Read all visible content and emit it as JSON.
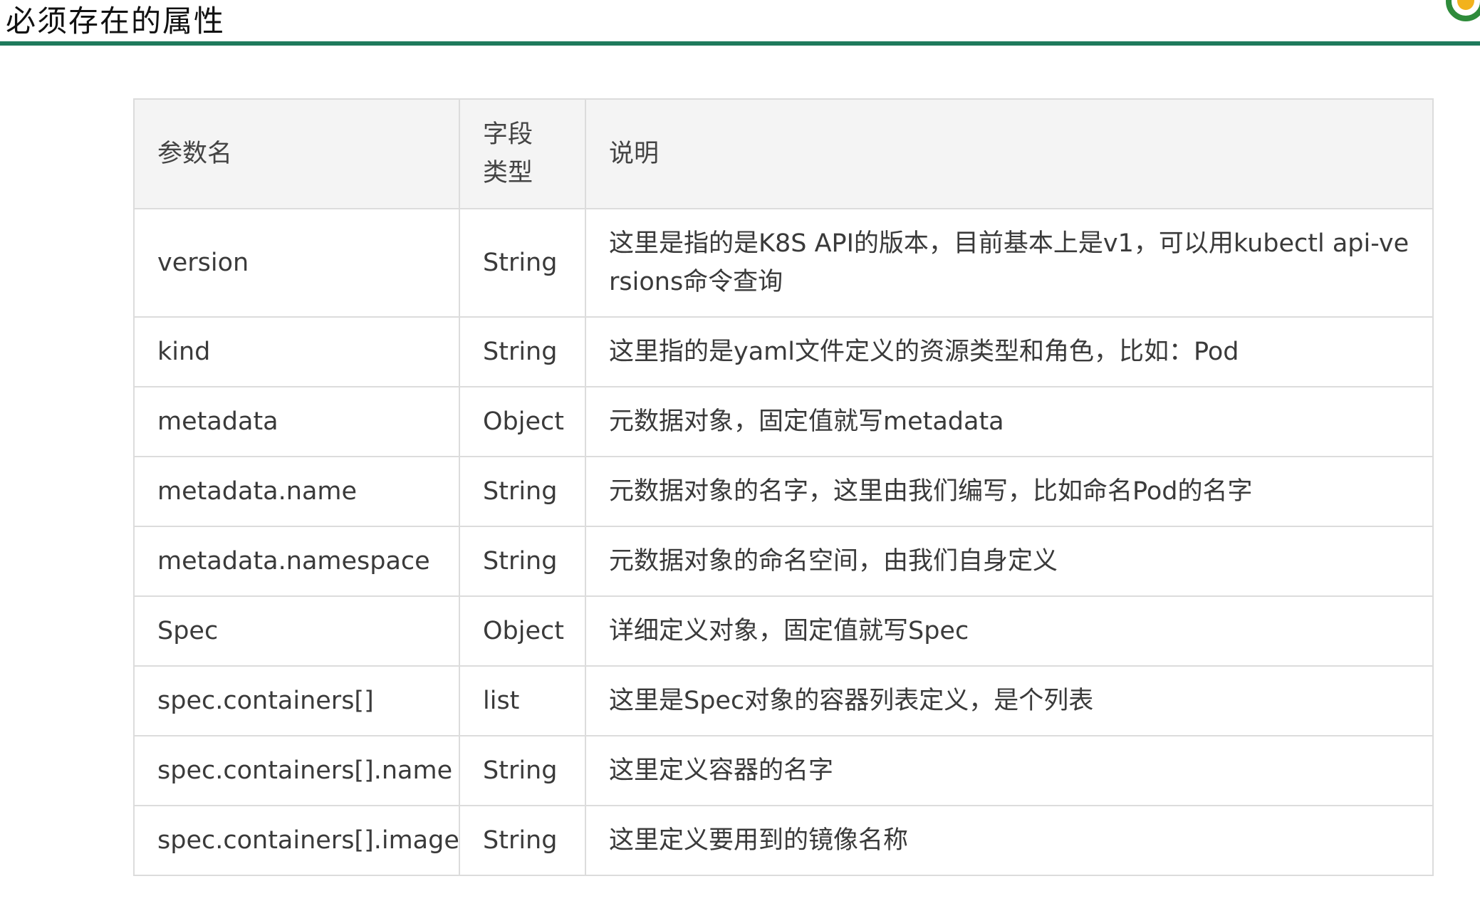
{
  "page": {
    "title": "必须存在的属性",
    "accent_color": "#1f7a5c"
  },
  "table": {
    "headers": {
      "name": "参数名",
      "type_line1": "字段",
      "type_line2": "类型",
      "desc": "说明"
    },
    "rows": [
      {
        "name": "version",
        "type": "String",
        "desc": "这里是指的是K8S API的版本，目前基本上是v1，可以用kubectl  api-versions命令查询"
      },
      {
        "name": "kind",
        "type": "String",
        "desc": "这里指的是yaml文件定义的资源类型和角色，比如：Pod"
      },
      {
        "name": "metadata",
        "type": "Object",
        "desc": "元数据对象，固定值就写metadata"
      },
      {
        "name": "metadata.name",
        "type": "String",
        "desc": "元数据对象的名字，这里由我们编写，比如命名Pod的名字"
      },
      {
        "name": "metadata.namespace",
        "type": "String",
        "desc": "元数据对象的命名空间，由我们自身定义"
      },
      {
        "name": "Spec",
        "type": "Object",
        "desc": "详细定义对象，固定值就写Spec"
      },
      {
        "name": "spec.containers[]",
        "type": "list",
        "desc": "这里是Spec对象的容器列表定义，是个列表"
      },
      {
        "name": "spec.containers[].name",
        "type": "String",
        "desc": "这里定义容器的名字"
      },
      {
        "name": "spec.containers[].image",
        "type": "String",
        "desc": "这里定义要用到的镜像名称"
      }
    ]
  }
}
